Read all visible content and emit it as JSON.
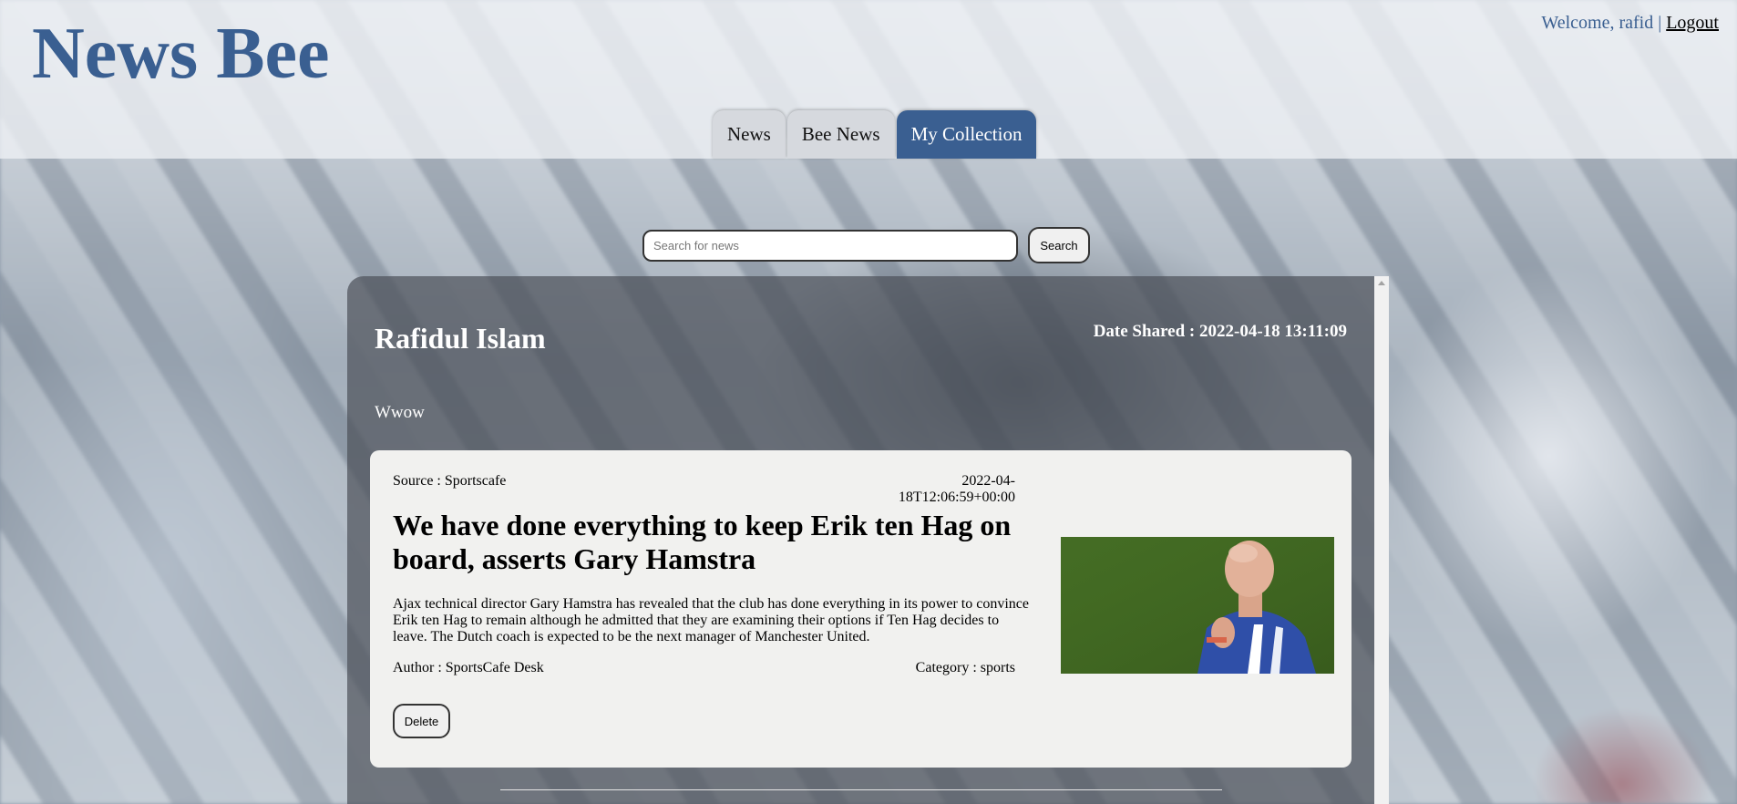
{
  "header": {
    "logo": "News Bee",
    "welcome_text": "Welcome, rafid",
    "separator": "|",
    "logout_label": "Logout"
  },
  "nav": {
    "tabs": [
      {
        "label": "News",
        "active": false
      },
      {
        "label": "Bee News",
        "active": false
      },
      {
        "label": "My Collection",
        "active": true
      }
    ]
  },
  "search": {
    "placeholder": "Search for news",
    "value": "",
    "button_label": "Search"
  },
  "post": {
    "shared_by": "Rafidul Islam",
    "date_shared": "Date Shared : 2022-04-18 13:11:09",
    "comment": "Wwow",
    "article": {
      "source": "Source : Sportscafe",
      "published": "2022-04-18T12:06:59+00:00",
      "headline": "We have done everything to keep Erik ten Hag on board, asserts Gary Hamstra",
      "description": "Ajax technical director Gary Hamstra has revealed that the club has done everything in its power to convince Erik ten Hag to remain although he admitted that they are examining their options if Ten Hag decides to leave. The Dutch coach is expected to be the next manager of Manchester United.",
      "author": "Author : SportsCafe Desk",
      "category": "Category : sports",
      "delete_label": "Delete"
    }
  },
  "colors": {
    "brand": "#3a5f91",
    "card_bg": "#f1f1ef",
    "post_bg": "#4b5058"
  }
}
